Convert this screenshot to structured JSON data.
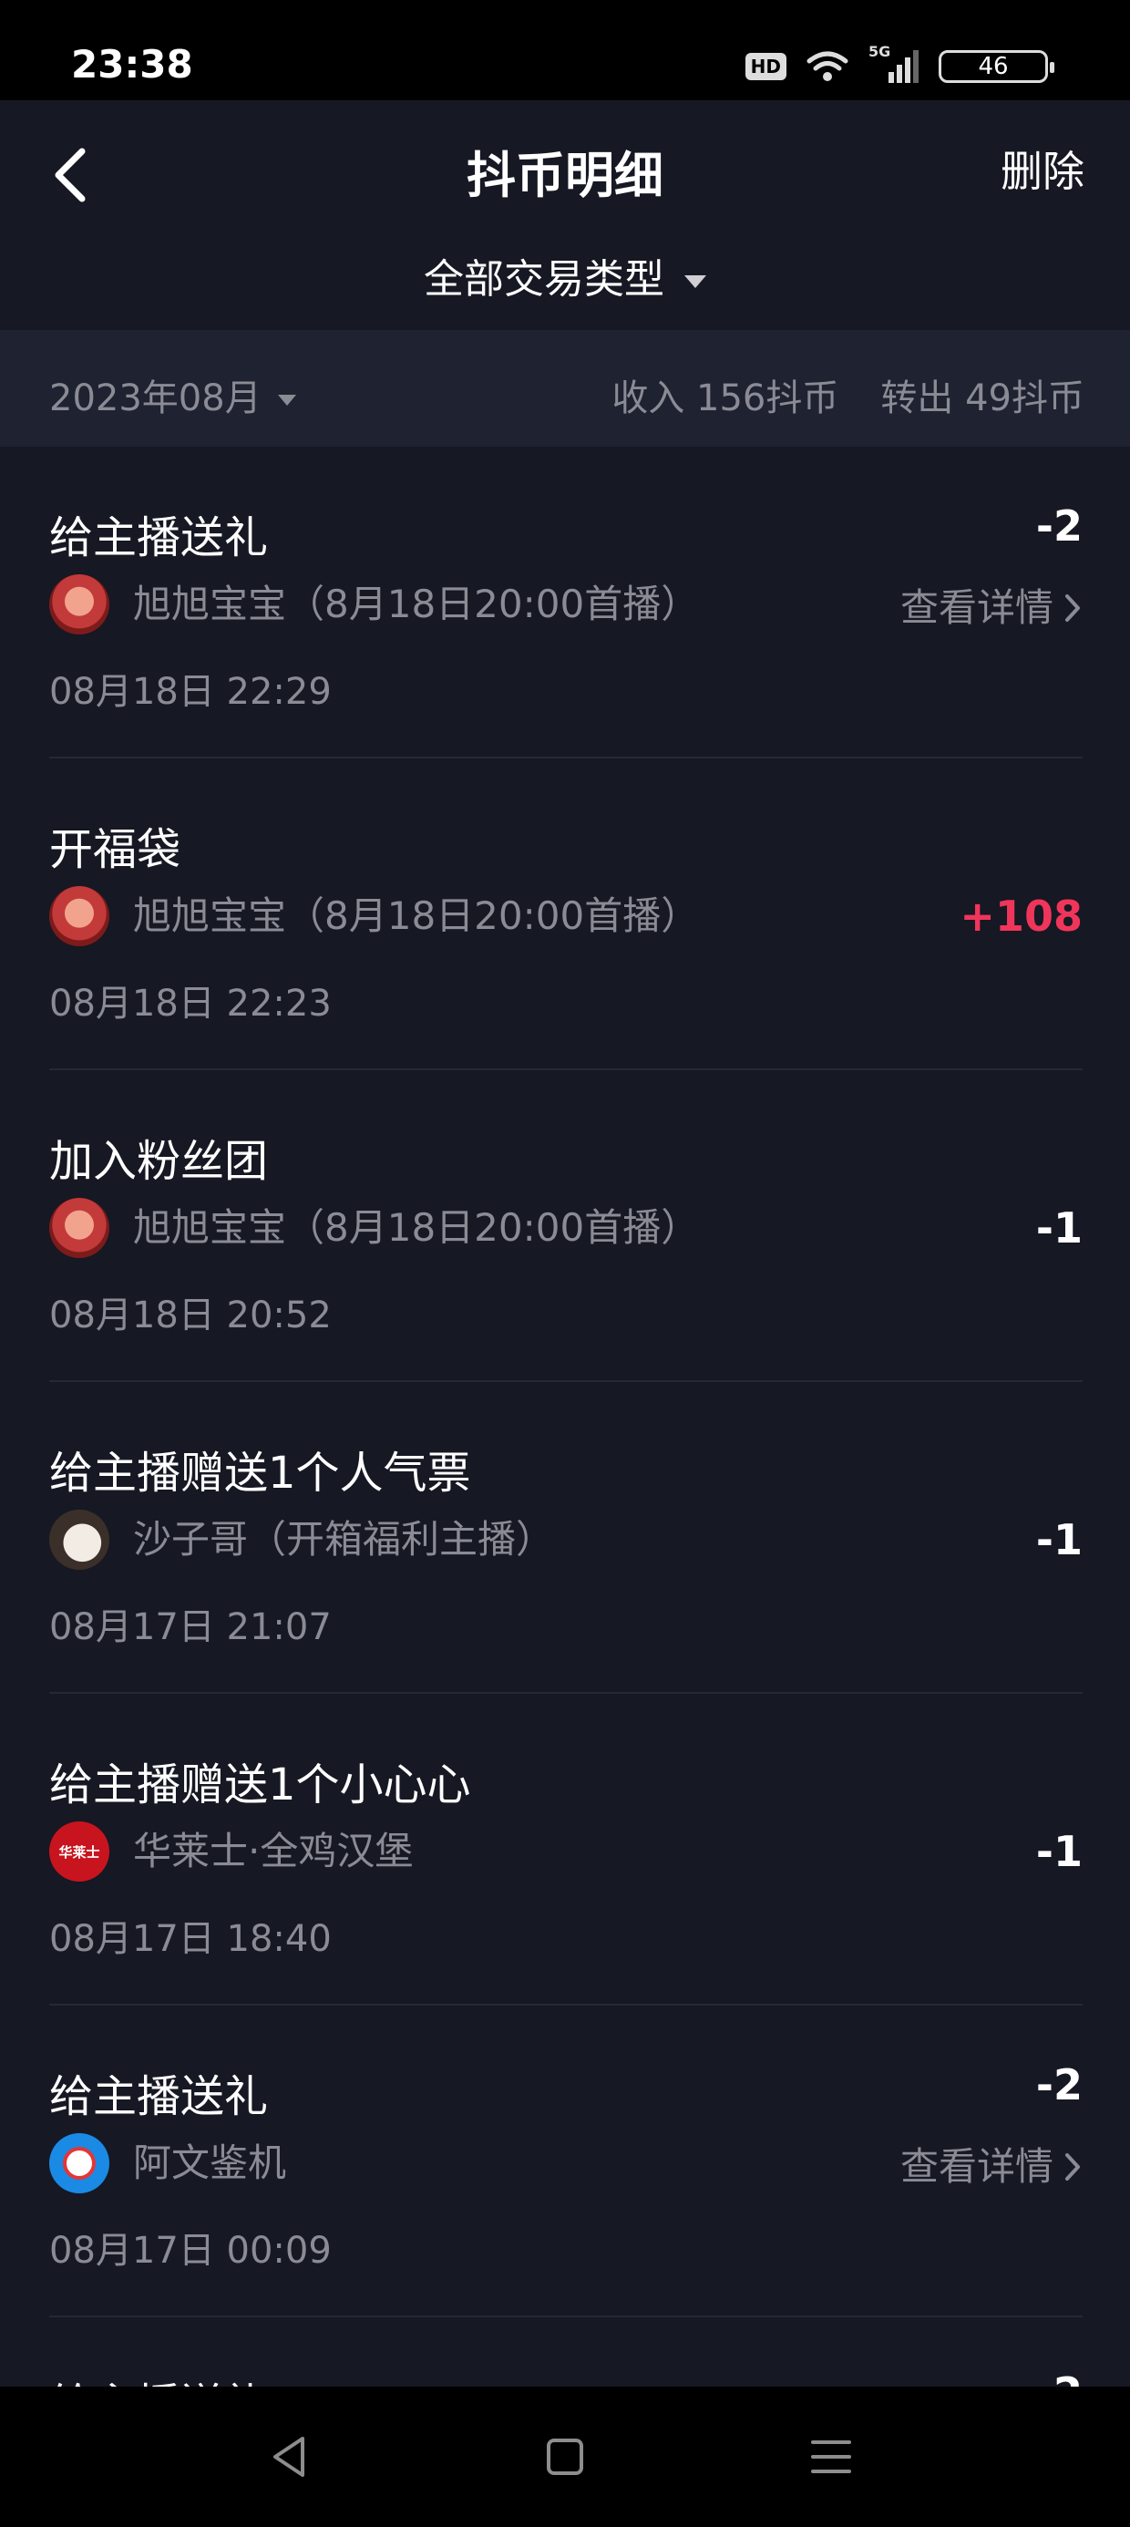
{
  "status_bar": {
    "time": "23:38",
    "hd": "HD",
    "network": "5G",
    "battery": "46"
  },
  "header": {
    "title": "抖币明细",
    "delete_label": "删除",
    "back_icon": "chevron-left-icon"
  },
  "filter": {
    "label": "全部交易类型"
  },
  "summary": {
    "month": "2023年08月",
    "income": "收入 156抖币",
    "outgo": "转出 49抖币"
  },
  "detail_label": "查看详情",
  "transactions": [
    {
      "title": "给主播送礼",
      "user": "旭旭宝宝（8月18日20:00首播）",
      "time": "08月18日 22:29",
      "amount": "-2",
      "has_detail": true
    },
    {
      "title": "开福袋",
      "user": "旭旭宝宝（8月18日20:00首播）",
      "time": "08月18日 22:23",
      "amount": "+108",
      "has_detail": false
    },
    {
      "title": "加入粉丝团",
      "user": "旭旭宝宝（8月18日20:00首播）",
      "time": "08月18日 20:52",
      "amount": "-1",
      "has_detail": false
    },
    {
      "title": "给主播赠送1个人气票",
      "user": "沙子哥（开箱福利主播）",
      "time": "08月17日 21:07",
      "amount": "-1",
      "has_detail": false
    },
    {
      "title": "给主播赠送1个小心心",
      "user": "华莱士·全鸡汉堡",
      "time": "08月17日 18:40",
      "amount": "-1",
      "has_detail": false
    },
    {
      "title": "给主播送礼",
      "user": "阿文鉴机",
      "time": "08月17日 00:09",
      "amount": "-2",
      "has_detail": true
    }
  ],
  "colors": {
    "background": "#161823",
    "summary_bg": "#1f2230",
    "positive": "#f0355b",
    "muted": "#8a8b95"
  },
  "avatar_labels": {
    "hualaishi": "华莱士"
  }
}
